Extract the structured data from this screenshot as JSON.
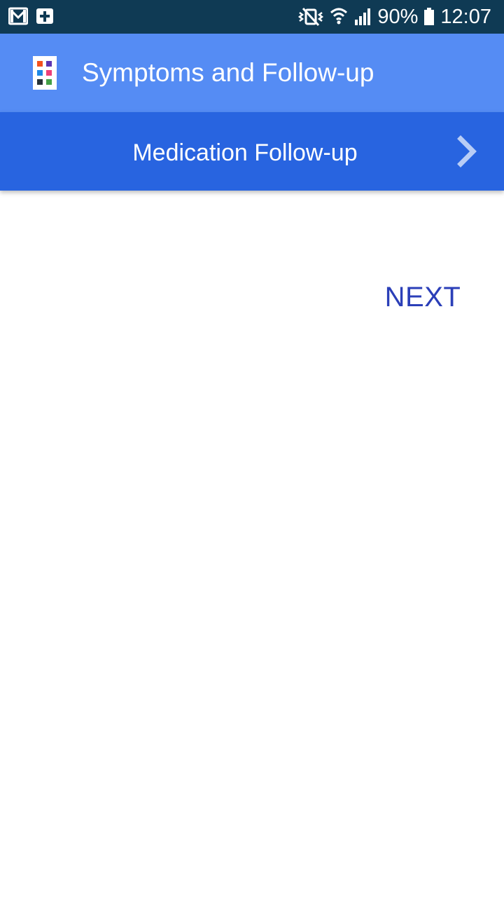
{
  "status_bar": {
    "left_icons": [
      "gmail-icon",
      "calendar-plus-icon"
    ],
    "right_icons": [
      "vibrate-mute-icon",
      "wifi-icon",
      "signal-icon",
      "battery-icon"
    ],
    "battery": "90%",
    "time": "12:07"
  },
  "app_bar": {
    "title": "Symptoms and Follow-up",
    "logo_icon": "app-grid-logo-icon"
  },
  "section_bar": {
    "title": "Medication Follow-up",
    "arrow_icon": "chevron-right-icon"
  },
  "actions": {
    "next_label": "NEXT"
  },
  "colors": {
    "status_bar": "#0f3a54",
    "app_bar": "#558cf4",
    "section_bar": "#2864e0",
    "next_text": "#2b3fb8"
  }
}
